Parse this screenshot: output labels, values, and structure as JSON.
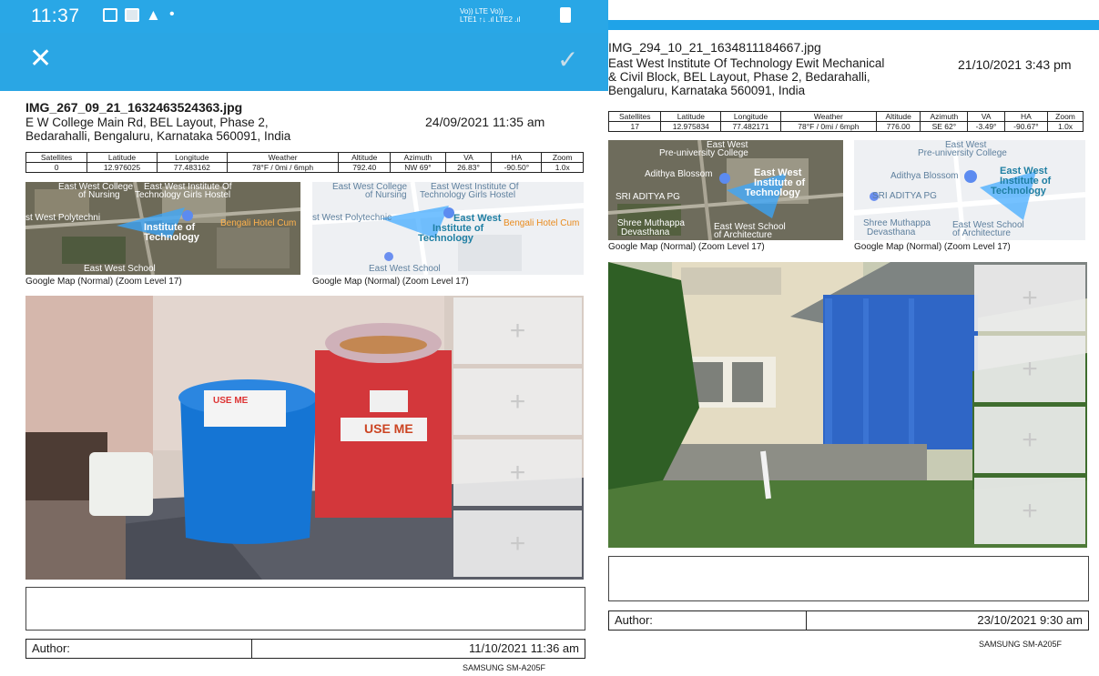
{
  "status_bar": {
    "time": "11:37",
    "network_line1": "Vo)) LTE  Vo))",
    "network_line2": "LTE1 ↑↓ .ıl LTE2 .ıl",
    "icons": [
      "image-icon",
      "gallery-icon",
      "alert-icon",
      "dot-icon",
      "battery-icon"
    ]
  },
  "app_bar": {
    "close_icon": "close-icon",
    "confirm_icon": "check-icon",
    "accent": "#2aa6e4"
  },
  "left": {
    "filename": "IMG_267_09_21_1632463524363.jpg",
    "address_line1": "E W College Main Rd, BEL Layout, Phase 2,",
    "address_line2": "Bedarahalli, Bengaluru, Karnataka 560091, India",
    "datetime": "24/09/2021 11:35 am",
    "table": {
      "headers": [
        "Satellites",
        "Latitude",
        "Longitude",
        "Weather",
        "Altitude",
        "Azimuth",
        "VA",
        "HA",
        "Zoom"
      ],
      "values": [
        "0",
        "12.976025",
        "77.483162",
        "78°F / 0mi / 6mph",
        "792.40",
        "NW 69°",
        "26.83°",
        "-90.50°",
        "1.0x"
      ]
    },
    "map_caption_1": "Google Map (Normal) (Zoom Level 17)",
    "map_caption_2": "Google Map (Normal) (Zoom Level 17)",
    "sat_labels": [
      "East West College",
      "of Nursing",
      "East West Institute Of",
      "Technology Girls Hostel",
      "st West Polytechni",
      "Institute of",
      "Technology",
      "Bengali Hotel Cum",
      "East West School"
    ],
    "map_labels": [
      "East West College",
      "of Nursing",
      "East West Institute Of",
      "Technology Girls Hostel",
      "st West Polytechnic",
      "East West",
      "Institute of",
      "Technology",
      "Bengali Hotel Cum",
      "East West School"
    ],
    "sign_text_1": "USE ME",
    "sign_text_2": "USE ME",
    "tiles": [
      "+",
      "+",
      "+",
      "+"
    ],
    "author_label": "Author:",
    "author_datetime": "11/10/2021 11:36 am",
    "device": "SAMSUNG SM-A205F"
  },
  "right": {
    "filename": "IMG_294_10_21_1634811184667.jpg",
    "address_line1": "East West Institute Of Technology Ewit Mechanical",
    "address_line2": "& Civil Block, BEL Layout, Phase 2, Bedarahalli,",
    "address_line3": "Bengaluru, Karnataka 560091, India",
    "datetime": "21/10/2021 3:43 pm",
    "table": {
      "headers": [
        "Satellites",
        "Latitude",
        "Longitude",
        "Weather",
        "Altitude",
        "Azimuth",
        "VA",
        "HA",
        "Zoom"
      ],
      "values": [
        "17",
        "12.975834",
        "77.482171",
        "78°F / 0mi / 6mph",
        "776.00",
        "SE 62°",
        "-3.49°",
        "-90.67°",
        "1.0x"
      ]
    },
    "map_caption_1": "Google Map (Normal) (Zoom Level 17)",
    "map_caption_2": "Google Map (Normal) (Zoom Level 17)",
    "sat_labels": [
      "East West",
      "Pre-university College",
      "Adithya Blossom",
      "East West",
      "Institute of",
      "Technology",
      "SRI ADITYA PG",
      "Shree Muthappa",
      "Devasthana",
      "East West School",
      "of Architecture"
    ],
    "map_labels": [
      "East West",
      "Pre-university College",
      "Adithya Blossom",
      "East West",
      "Institute of",
      "Technology",
      "SRI ADITYA PG",
      "Shree Muthappa",
      "Devasthana",
      "East West School",
      "of Architecture"
    ],
    "tiles": [
      "+",
      "+",
      "+",
      "+"
    ],
    "author_label": "Author:",
    "author_datetime": "23/10/2021 9:30 am",
    "device": "SAMSUNG SM-A205F"
  }
}
